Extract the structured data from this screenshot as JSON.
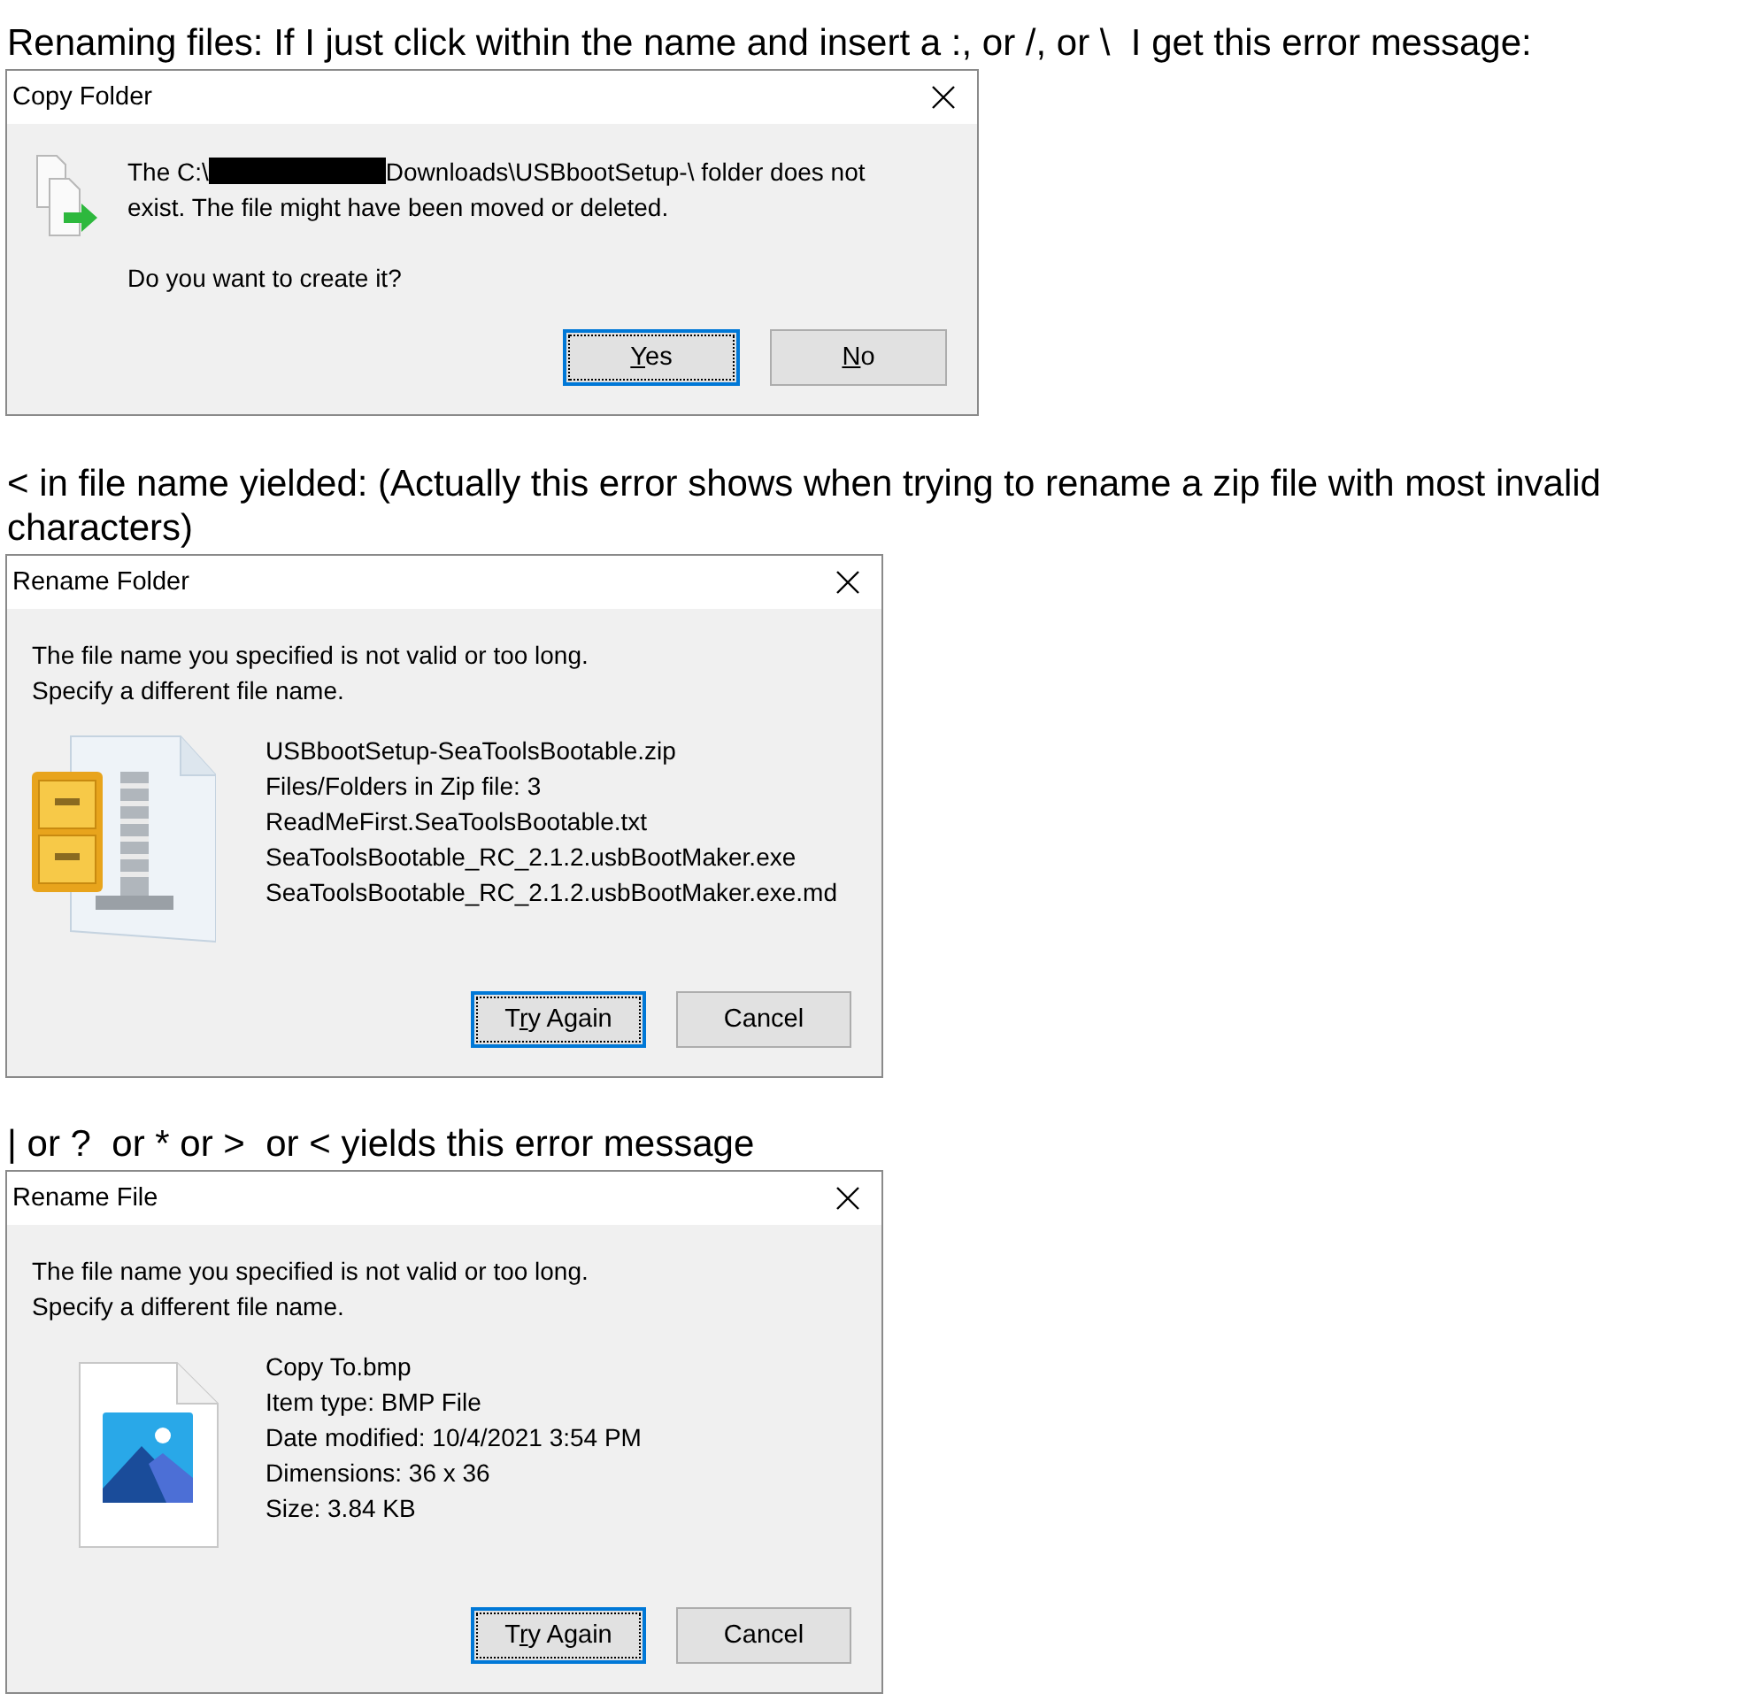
{
  "sections": [
    {
      "caption": "Renaming files: If I just click within the name and insert a :, or /, or \\  I get this error message:",
      "dialog": {
        "kind": "confirm",
        "title": "Copy Folder",
        "message": {
          "before": "The C:\\",
          "redacted": true,
          "after": "Downloads\\USBbootSetup-\\ folder does not exist. The file might have been moved or deleted."
        },
        "question": "Do you want to create it?",
        "buttons": [
          {
            "key": "Y",
            "after": "es",
            "focused": true
          },
          {
            "key": "N",
            "after": "o",
            "focused": false
          }
        ]
      }
    },
    {
      "caption": "< in file name yielded: (Actually this error shows when trying to rename a zip file with most invalid characters)",
      "dialog": {
        "kind": "error",
        "title": "Rename Folder",
        "message_lines": [
          "The file name you specified is not valid or too long.",
          "Specify a different file name."
        ],
        "details": [
          "USBbootSetup-SeaToolsBootable.zip",
          "Files/Folders in Zip file: 3",
          "ReadMeFirst.SeaToolsBootable.txt",
          "SeaToolsBootable_RC_2.1.2.usbBootMaker.exe",
          "SeaToolsBootable_RC_2.1.2.usbBootMaker.exe.md"
        ],
        "buttons": [
          {
            "before": "T",
            "key": "r",
            "after": "y Again",
            "focused": true
          },
          {
            "before": "Cancel",
            "focused": false
          }
        ]
      }
    },
    {
      "caption": "| or ?  or * or >  or < yields this error message",
      "dialog": {
        "kind": "error",
        "title": "Rename File",
        "message_lines": [
          "The file name you specified is not valid or too long.",
          "Specify a different file name."
        ],
        "details": [
          "Copy To.bmp",
          "Item type: BMP File",
          "Date modified: 10/4/2021 3:54 PM",
          "Dimensions: 36 x 36",
          "Size: 3.84 KB"
        ],
        "buttons": [
          {
            "before": "T",
            "key": "r",
            "after": "y Again",
            "focused": true
          },
          {
            "before": "Cancel",
            "focused": false
          }
        ]
      }
    }
  ]
}
